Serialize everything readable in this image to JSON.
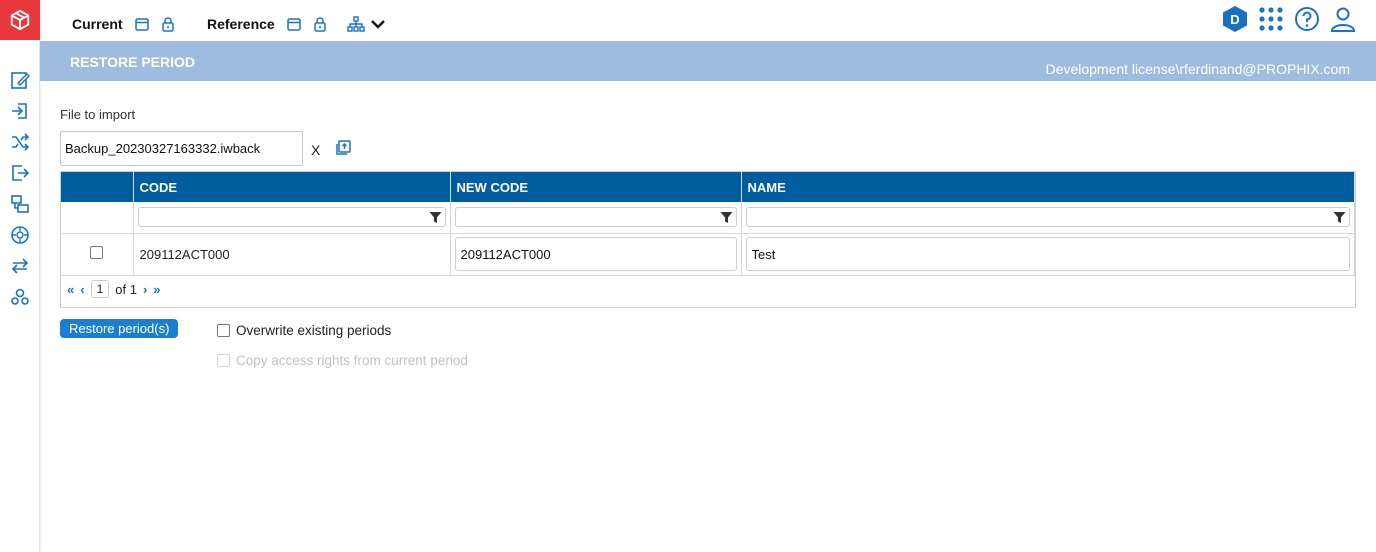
{
  "header": {
    "current_label": "Current",
    "reference_label": "Reference"
  },
  "banner": {
    "title": "RESTORE PERIOD",
    "license": "Development license\\rferdinand@PROPHIX.com"
  },
  "file": {
    "label": "File to import",
    "value": "Backup_20230327163332.iwback",
    "clear": "X"
  },
  "grid": {
    "columns": [
      "CODE",
      "NEW CODE",
      "NAME"
    ],
    "rows": [
      {
        "code": "209112ACT000",
        "new_code": "209112ACT000",
        "name": "Test",
        "checked": false
      }
    ],
    "pager": {
      "page": "1",
      "of": "of 1"
    }
  },
  "actions": {
    "restore": "Restore period(s)",
    "overwrite": "Overwrite existing periods",
    "copy_rights": "Copy access rights from current period"
  },
  "colors": {
    "accent": "#1a7fd0",
    "grid_header": "#005e9e",
    "banner": "#9dbcdf",
    "logo": "#e8383d"
  }
}
